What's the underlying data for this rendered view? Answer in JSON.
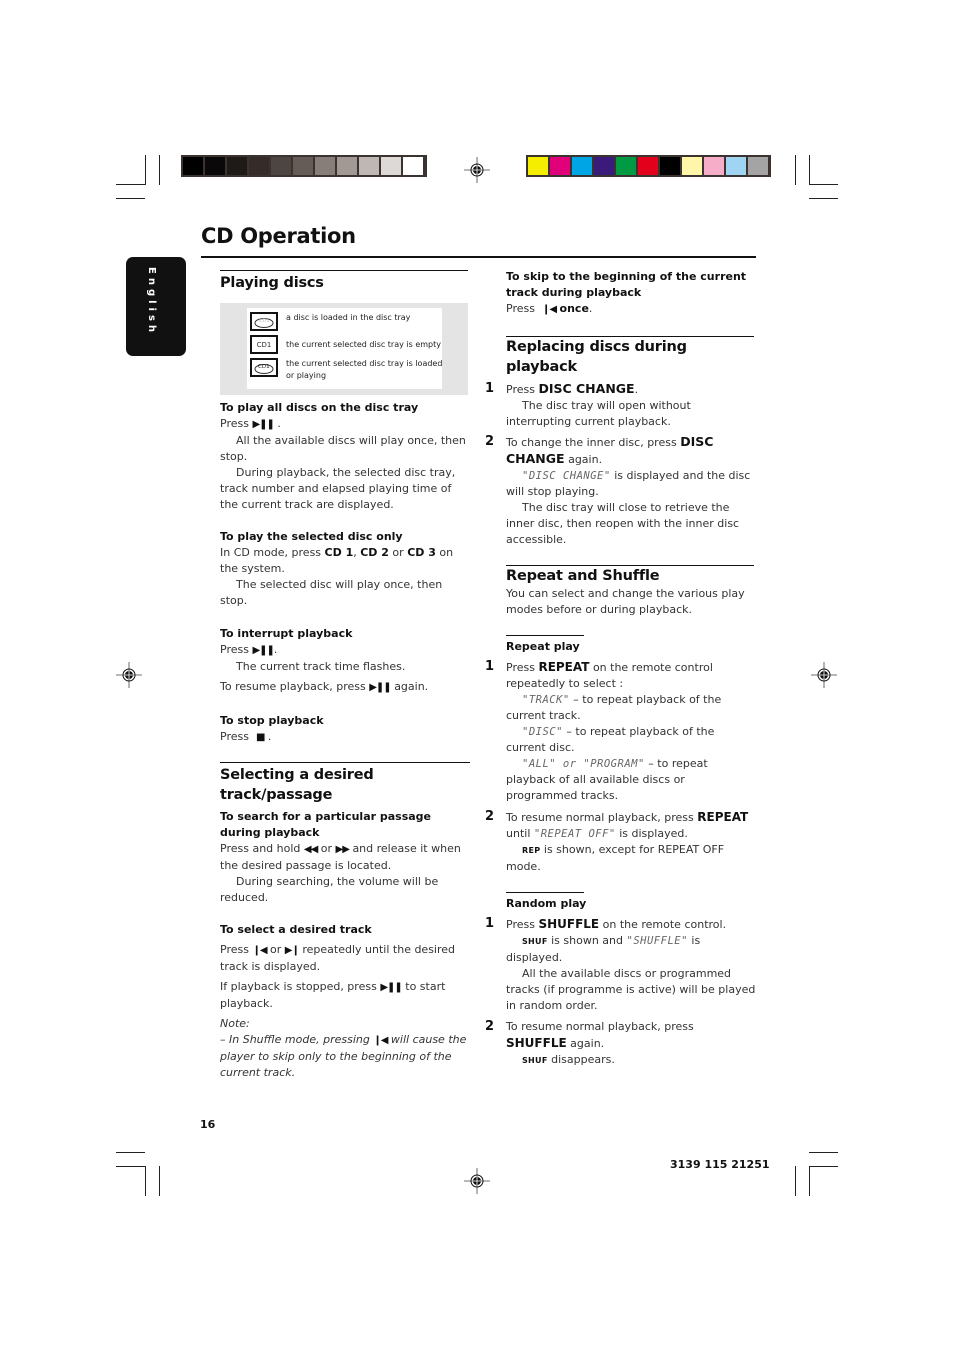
{
  "print_marks": {
    "gray_swatches": [
      "#000000",
      "#0a0808",
      "#1e1a18",
      "#352c29",
      "#4c4542",
      "#655c58",
      "#877d79",
      "#a29894",
      "#bfb7b3",
      "#ddd9d6",
      "#ffffff"
    ],
    "color_swatches": [
      "#f6ee00",
      "#e2007a",
      "#00a5e5",
      "#3a1a7a",
      "#009a44",
      "#e3001b",
      "#000000",
      "#fff6aa",
      "#f5adc8",
      "#9fd4f2",
      "#a4a4a4"
    ],
    "registration_icon": "crosshair-target-icon"
  },
  "page": {
    "title": "CD Operation",
    "language_tab": "English",
    "page_number": "16",
    "doc_code": "3139 115 21251"
  },
  "left": {
    "playing_discs": {
      "heading": "Playing discs",
      "legend": [
        {
          "icon": "disc-loaded-icon",
          "icon_text": "CD1",
          "text": "a disc is loaded in the disc tray"
        },
        {
          "icon": "disc-tray-empty-icon",
          "icon_text": "CD1",
          "text": "the current selected disc tray is empty"
        },
        {
          "icon": "disc-tray-playing-icon",
          "icon_text": "CD1",
          "text": "the current selected disc tray is loaded or playing"
        }
      ],
      "play_all": {
        "heading": "To play all discs on the disc tray",
        "press": "Press",
        "button": "▶❚❚",
        "after": ".",
        "line1": "All the available discs will play once, then stop.",
        "line2": "During playback, the selected disc tray, track number and elapsed playing time of the current track are displayed."
      },
      "play_selected": {
        "heading": "To play the selected disc only",
        "pre": "In CD mode, press",
        "cd1": "CD 1",
        "comma": ",",
        "cd2": "CD 2",
        "or": "or",
        "cd3": "CD 3",
        "post": "on the system.",
        "line": "The selected disc will play once, then stop."
      },
      "interrupt": {
        "heading": "To interrupt playback",
        "press": "Press",
        "button": "▶❚❚",
        "after": ".",
        "line": "The current track time flashes.",
        "resume_pre": "To resume playback, press",
        "resume_button": "▶❚❚",
        "resume_post": "again."
      },
      "stop": {
        "heading": "To stop playback",
        "press": "Press",
        "button": "■",
        "after": "."
      }
    },
    "selecting": {
      "heading": "Selecting a desired track/passage",
      "search": {
        "heading": "To search for a particular passage during playback",
        "pre": "Press and hold",
        "rew": "◀◀",
        "or": "or",
        "ffw": "▶▶",
        "post": "and release it when the desired passage is located.",
        "line": "During searching, the volume will be reduced."
      },
      "select_track": {
        "heading": "To select a desired track",
        "pre": "Press",
        "prev": "❙◀",
        "or": "or",
        "next": "▶❙",
        "post": "repeatedly until the desired track is displayed.",
        "stopped_pre": "If playback is stopped, press",
        "stopped_button": "▶❚❚",
        "stopped_post": "to start playback.",
        "note_label": "Note:",
        "note_pre": "–  In Shuffle mode, pressing",
        "note_button": "❙◀",
        "note_post": "will cause the player to skip only to the beginning of the current track."
      }
    }
  },
  "right": {
    "skip": {
      "heading": "To skip to the beginning of the current track during playback",
      "press": "Press",
      "button": "❙◀",
      "once": "once",
      "after": "."
    },
    "replacing": {
      "heading": "Replacing discs during playback",
      "steps": [
        {
          "num": "1",
          "pre": "Press",
          "key": "DISC CHANGE",
          "post": ".",
          "line": "The disc tray will open without interrupting current playback."
        },
        {
          "num": "2",
          "pre": "To change the inner disc, press",
          "key": "DISC CHANGE",
          "post": "again.",
          "lcd": "\"DISC CHANGE\"",
          "lcd_post": "is displayed and the disc will stop playing.",
          "line": "The disc tray will close to retrieve the inner disc, then reopen with the inner disc accessible."
        }
      ]
    },
    "repeat_shuffle": {
      "heading": "Repeat and Shuffle",
      "intro": "You can select and change the various play modes before or during playback.",
      "repeat": {
        "heading": "Repeat play",
        "step1": {
          "num": "1",
          "pre": "Press",
          "key": "REPEAT",
          "post": "on the remote control repeatedly to select :"
        },
        "options": [
          {
            "lcd": "\"TRACK\"",
            "text": " – to repeat playback of the current track."
          },
          {
            "lcd": "\"DISC\"",
            "text": " – to repeat playback of the current disc."
          },
          {
            "lcd": "\"ALL\" or \"PROGRAM\"",
            "text": " – to repeat playback of all available discs or programmed tracks."
          }
        ],
        "step2": {
          "num": "2",
          "pre": "To resume normal playback, press",
          "key": "REPEAT",
          "mid": "until",
          "lcd": "\"REPEAT OFF\"",
          "post": "is displayed.",
          "indicator": "REP",
          "indicator_text": "is shown, except for REPEAT OFF mode."
        }
      },
      "random": {
        "heading": "Random play",
        "step1": {
          "num": "1",
          "pre": "Press",
          "key": "SHUFFLE",
          "post": "on the remote control.",
          "indicator": "SHUF",
          "ind_mid": "is shown and",
          "lcd": "\"SHUFFLE\"",
          "ind_post": "is displayed.",
          "line": "All the available discs or programmed tracks (if programme is active) will be played in random order."
        },
        "step2": {
          "num": "2",
          "pre": "To resume normal playback, press",
          "key": "SHUFFLE",
          "post": "again.",
          "indicator": "SHUF",
          "indicator_text": "disappears."
        }
      }
    }
  }
}
